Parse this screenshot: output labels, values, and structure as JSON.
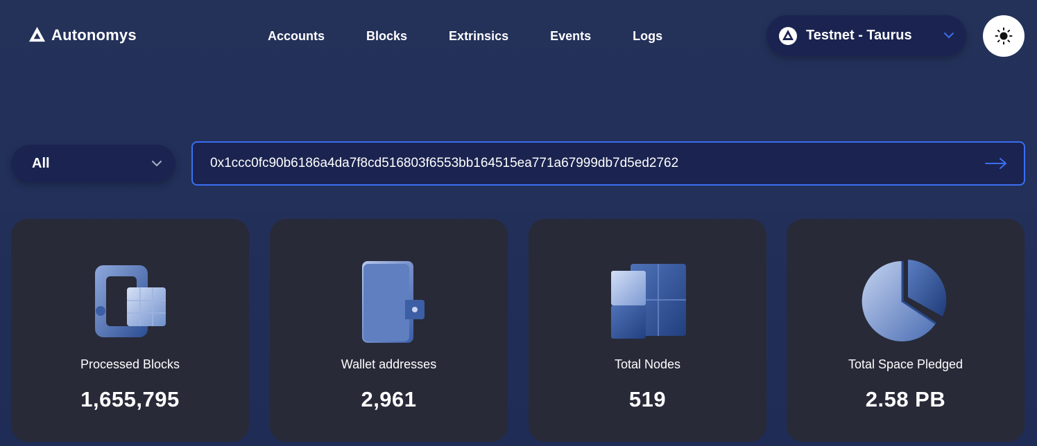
{
  "brand": {
    "name": "Autonomys"
  },
  "nav": {
    "items": [
      "Accounts",
      "Blocks",
      "Extrinsics",
      "Events",
      "Logs"
    ]
  },
  "network": {
    "label": "Testnet - Taurus",
    "icon": "autonomys-logo-icon"
  },
  "theme_toggle": {
    "icon": "sun-icon"
  },
  "search": {
    "filter": "All",
    "value": "0x1ccc0fc90b6186a4da7f8cd516803f6553bb164515ea771a67999db7d5ed2762",
    "submit_icon": "arrow-right-icon"
  },
  "stats": [
    {
      "label": "Processed Blocks",
      "value": "1,655,795",
      "icon": "block-cube-icon"
    },
    {
      "label": "Wallet addresses",
      "value": "2,961",
      "icon": "wallet-icon"
    },
    {
      "label": "Total Nodes",
      "value": "519",
      "icon": "nodes-cube-icon"
    },
    {
      "label": "Total Space Pledged",
      "value": "2.58 PB",
      "icon": "pie-chart-icon"
    }
  ],
  "colors": {
    "background": "#22305a",
    "card": "#282a38",
    "accent": "#3b6ff2",
    "pill": "#1b2450"
  }
}
